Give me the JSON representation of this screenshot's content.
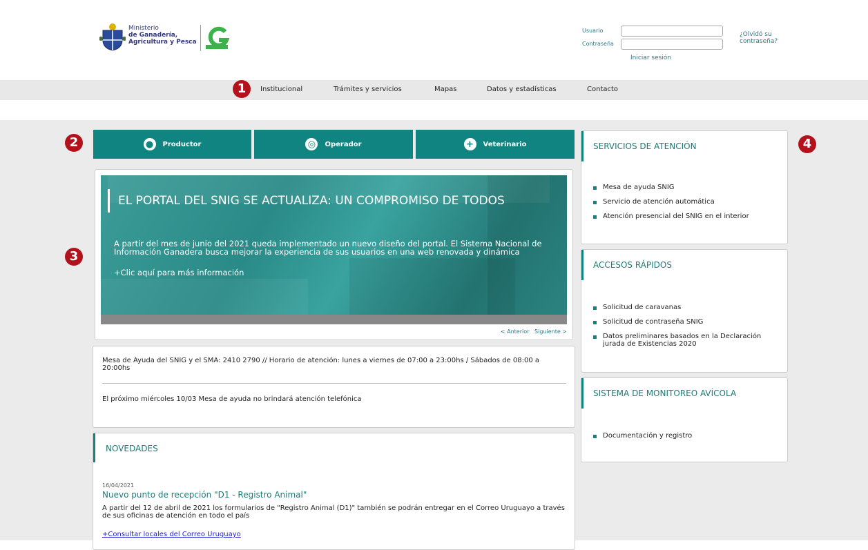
{
  "header": {
    "ministry_lines": [
      "Ministerio",
      "de Ganadería,",
      "Agricultura y Pesca"
    ],
    "login": {
      "user_label": "Usuario",
      "password_label": "Contraseña",
      "login_button": "Iniciar sesión",
      "forgot_line1": "¿Olvidó su",
      "forgot_line2": "contraseña?"
    }
  },
  "nav": {
    "items": [
      "Institucional",
      "Trámites y servicios",
      "Mapas",
      "Datos y estadísticas",
      "Contacto"
    ]
  },
  "badges": [
    "1",
    "2",
    "3",
    "4"
  ],
  "roles": [
    "Productor",
    "Operador",
    "Veterinario"
  ],
  "slider": {
    "title": "EL PORTAL DEL SNIG SE ACTUALIZA: UN COMPROMISO DE TODOS",
    "text": "A partir del mes de junio del 2021 queda implementado un nuevo diseño del portal. El Sistema Nacional de Información Ganadera busca mejorar la experiencia de sus usuarios en una web renovada y dinámica",
    "more": "+Clic aquí para más información",
    "prev": "< Anterior",
    "next": "Siguiente >"
  },
  "notice": {
    "line1": "Mesa de Ayuda del SNIG y el SMA: 2410 2790 // Horario de atención: lunes a viernes de 07:00 a 23:00hs / Sábados de 08:00 a 20:00hs",
    "line2": "El próximo miércoles 10/03 Mesa de ayuda no brindará atención telefónica"
  },
  "news": {
    "title": "NOVEDADES",
    "date": "16/04/2021",
    "headline": "Nuevo punto de recepción \"D1 - Registro Animal\"",
    "body": "A partir del 12 de abril de 2021 los formularios de \"Registro Animal (D1)\" también se podrán entregar en el Correo Uruguayo a través de sus oficinas de atención en todo el país",
    "link": "+Consultar locales del Correo Uruguayo"
  },
  "sidebar": {
    "panels": [
      {
        "title": "SERVICIOS DE ATENCIÓN",
        "items": [
          "Mesa de ayuda SNIG",
          "Servicio de atención automática",
          "Atención presencial del SNIG en el interior"
        ]
      },
      {
        "title": "ACCESOS RÁPIDOS",
        "items": [
          "Solicitud de caravanas",
          "Solicitud de contraseña SNIG",
          "Datos preliminares basados en la Declaración jurada de Existencias 2020"
        ]
      },
      {
        "title": "SISTEMA DE MONITOREO AVÍCOLA",
        "items": [
          "Documentación y registro"
        ]
      }
    ]
  },
  "colors": {
    "teal": "#0f8480",
    "badge_red": "#b3111c",
    "link": "#2a7a8a"
  }
}
